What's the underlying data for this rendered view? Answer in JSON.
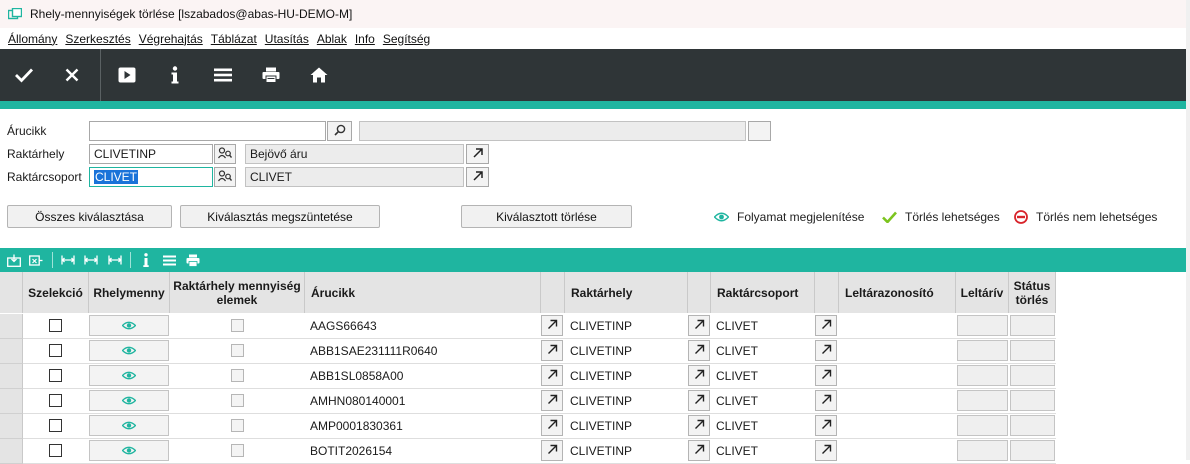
{
  "window": {
    "title": "Rhely-mennyiségek törlése  [lszabados@abas-HU-DEMO-M]"
  },
  "menu": [
    {
      "label": "Állomány"
    },
    {
      "label": "Szerkesztés"
    },
    {
      "label": "Végrehajtás"
    },
    {
      "label": "Táblázat"
    },
    {
      "label": "Utasítás"
    },
    {
      "label": "Ablak"
    },
    {
      "label": "Info"
    },
    {
      "label": "Segítség"
    }
  ],
  "toolbar": {
    "icons": [
      "check-icon",
      "close-icon",
      "play-icon",
      "info-icon",
      "menu-icon",
      "print-icon",
      "home-icon"
    ]
  },
  "form": {
    "arucikk": {
      "label": "Árucikk",
      "value": "",
      "desc": ""
    },
    "raktarhely": {
      "label": "Raktárhely",
      "value": "CLIVETINP",
      "desc": "Bejövő áru"
    },
    "raktarcsoport": {
      "label": "Raktárcsoport",
      "value": "CLIVET",
      "desc": "CLIVET"
    }
  },
  "actions": {
    "select_all": "Összes kiválasztása",
    "deselect": "Kiválasztás megszüntetése",
    "delete_selected": "Kiválasztott törlése"
  },
  "legend": {
    "progress": "Folyamat megjelenítése",
    "deletable": "Törlés lehetséges",
    "not_deletable": "Törlés nem lehetséges"
  },
  "colors": {
    "accent": "#1fb5a0",
    "toolbar": "#2f3537",
    "ok": "#7cc41f",
    "error": "#d8232a",
    "selection": "#1a73d9"
  },
  "table": {
    "headers": {
      "szelekcio": "Szelekció",
      "rhelymenny": "Rhelymenny",
      "elemek": "Raktárhely mennyiség elemek",
      "arucikk": "Árucikk",
      "raktarhely": "Raktárhely",
      "raktarcsoport": "Raktárcsoport",
      "leltarazonosito": "Leltárazonosító",
      "leltariv": "Leltárív",
      "statusz": "Státus törlés"
    },
    "rows": [
      {
        "arucikk": "AAGS66643",
        "raktarhely": "CLIVETINP",
        "raktarcsoport": "CLIVET"
      },
      {
        "arucikk": "ABB1SAE231111R0640",
        "raktarhely": "CLIVETINP",
        "raktarcsoport": "CLIVET"
      },
      {
        "arucikk": "ABB1SL0858A00",
        "raktarhely": "CLIVETINP",
        "raktarcsoport": "CLIVET"
      },
      {
        "arucikk": "AMHN080140001",
        "raktarhely": "CLIVETINP",
        "raktarcsoport": "CLIVET"
      },
      {
        "arucikk": "AMP0001830361",
        "raktarhely": "CLIVETINP",
        "raktarcsoport": "CLIVET"
      },
      {
        "arucikk": "BOTIT2026154",
        "raktarhely": "CLIVETINP",
        "raktarcsoport": "CLIVET"
      }
    ]
  }
}
